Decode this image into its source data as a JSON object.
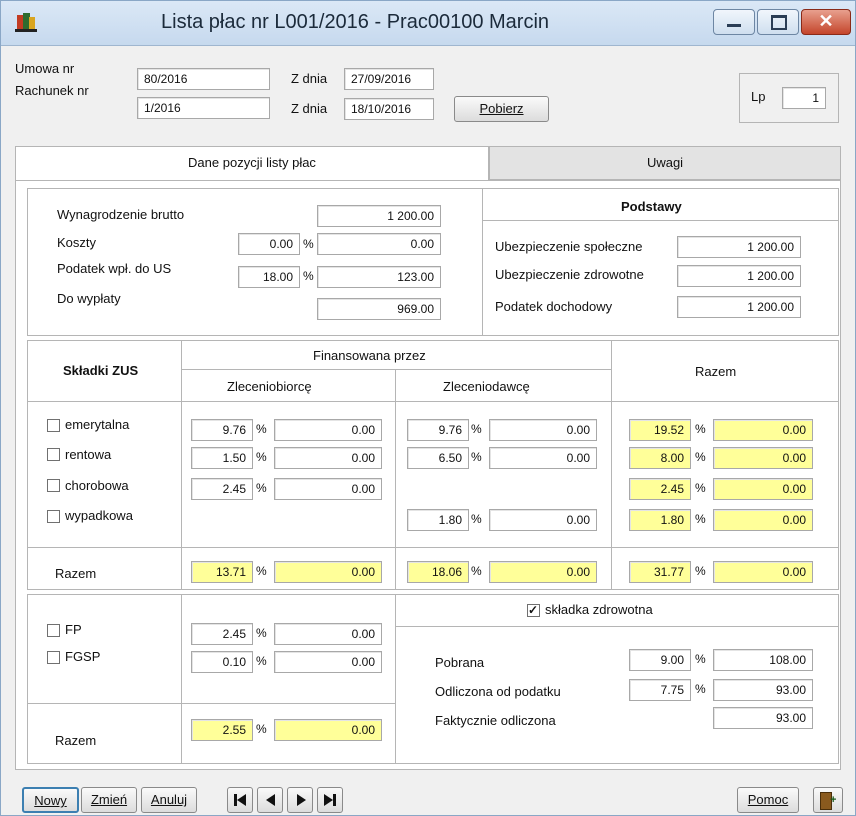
{
  "window": {
    "title": "Lista płac nr L001/2016 - Prac00100 Marcin"
  },
  "header": {
    "umowa_label": "Umowa nr",
    "umowa_value": "80/2016",
    "rachunek_label": "Rachunek nr",
    "rachunek_value": "1/2016",
    "zdnia_label": "Z dnia",
    "umowa_date": "27/09/2016",
    "rachunek_date": "18/10/2016",
    "pobierz_label": "Pobierz",
    "lp_label": "Lp",
    "lp_value": "1"
  },
  "tabs": [
    {
      "label": "Dane pozycji listy płac",
      "active": true
    },
    {
      "label": "Uwagi",
      "active": false
    }
  ],
  "summary": {
    "wynagrodzenie_label": "Wynagrodzenie brutto",
    "wynagrodzenie": "1 200.00",
    "koszty_label": "Koszty",
    "koszty_pct": "0.00",
    "koszty": "0.00",
    "podatek_label": "Podatek wpł. do US",
    "podatek_pct": "18.00",
    "podatek": "123.00",
    "dowyplaty_label": "Do wypłaty",
    "dowyplaty": "969.00",
    "pct_sign": "%"
  },
  "podstawy": {
    "title": "Podstawy",
    "spoleczne_label": "Ubezpieczenie społeczne",
    "spoleczne": "1 200.00",
    "zdrowotne_label": "Ubezpieczenie zdrowotne",
    "zdrowotne": "1 200.00",
    "dochodowy_label": "Podatek dochodowy",
    "dochodowy": "1 200.00"
  },
  "zus": {
    "title": "Składki ZUS",
    "financed_by": "Finansowana przez",
    "col_zleceniobiorce": "Zleceniobiorcę",
    "col_zleceniodawce": "Zleceniodawcę",
    "col_razem": "Razem",
    "rows": [
      {
        "name": "emerytalna",
        "zb_pct": "9.76",
        "zb": "0.00",
        "zd_pct": "9.76",
        "zd": "0.00",
        "r_pct": "19.52",
        "r": "0.00"
      },
      {
        "name": "rentowa",
        "zb_pct": "1.50",
        "zb": "0.00",
        "zd_pct": "6.50",
        "zd": "0.00",
        "r_pct": "8.00",
        "r": "0.00"
      },
      {
        "name": "chorobowa",
        "zb_pct": "2.45",
        "zb": "0.00",
        "r_pct": "2.45",
        "r": "0.00"
      },
      {
        "name": "wypadkowa",
        "zd_pct": "1.80",
        "zd": "0.00",
        "r_pct": "1.80",
        "r": "0.00"
      }
    ],
    "razem_label": "Razem",
    "totals": {
      "zb_pct": "13.71",
      "zb": "0.00",
      "zd_pct": "18.06",
      "zd": "0.00",
      "r_pct": "31.77",
      "r": "0.00"
    }
  },
  "fp": {
    "fp_label": "FP",
    "fp_pct": "2.45",
    "fp": "0.00",
    "fgsp_label": "FGSP",
    "fgsp_pct": "0.10",
    "fgsp": "0.00",
    "razem_label": "Razem",
    "razem_pct": "2.55",
    "razem": "0.00"
  },
  "zdrowotna": {
    "checkbox_label": "składka zdrowotna",
    "checked": true,
    "pobrana_label": "Pobrana",
    "pobrana_pct": "9.00",
    "pobrana": "108.00",
    "odliczona_label": "Odliczona od podatku",
    "odliczona_pct": "7.75",
    "odliczona": "93.00",
    "faktycznie_label": "Faktycznie odliczona",
    "faktycznie": "93.00"
  },
  "footer": {
    "nowy_label": "Nowy",
    "zmien_label": "Zmień",
    "anuluj_label": "Anuluj",
    "pomoc_label": "Pomoc"
  },
  "colors": {
    "highlight": "#ffff99",
    "titlebar": "#c6d9ee",
    "close_button": "#c4452b"
  }
}
